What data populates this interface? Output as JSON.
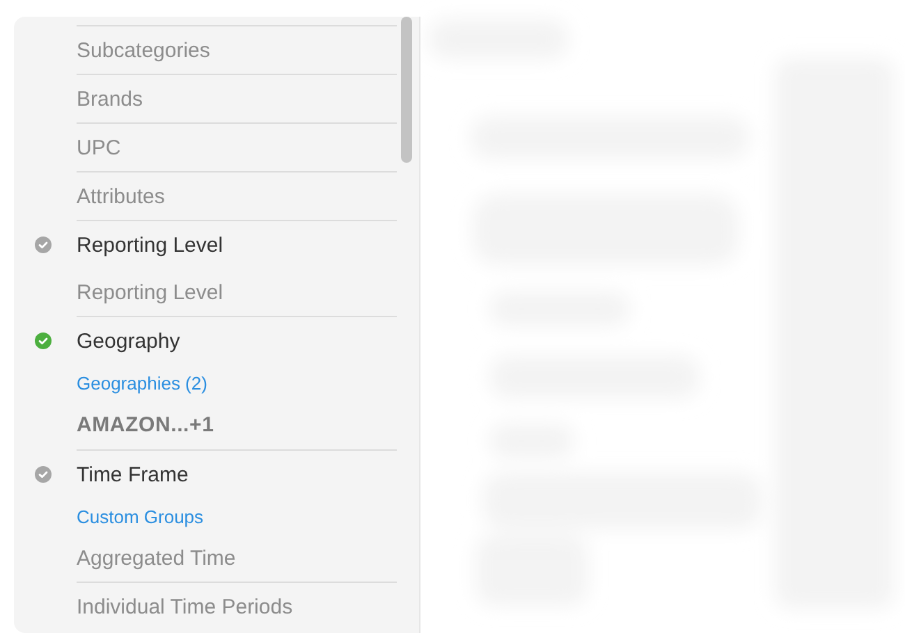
{
  "filter_groups": [
    {
      "items": [
        {
          "kind": "option",
          "label": "Subcategories"
        }
      ]
    },
    {
      "items": [
        {
          "kind": "option",
          "label": "Brands"
        }
      ]
    },
    {
      "items": [
        {
          "kind": "option",
          "label": "UPC"
        }
      ]
    },
    {
      "items": [
        {
          "kind": "option",
          "label": "Attributes"
        }
      ]
    },
    {
      "items": [
        {
          "kind": "header",
          "label": "Reporting Level",
          "complete": false
        },
        {
          "kind": "option",
          "label": "Reporting Level"
        }
      ]
    },
    {
      "items": [
        {
          "kind": "header",
          "label": "Geography",
          "complete": true
        },
        {
          "kind": "link",
          "label": "Geographies (2)"
        },
        {
          "kind": "value",
          "label": "AMAZON...+1"
        }
      ]
    },
    {
      "items": [
        {
          "kind": "header",
          "label": "Time Frame",
          "complete": false
        },
        {
          "kind": "link",
          "label": "Custom Groups"
        },
        {
          "kind": "option",
          "label": "Aggregated Time"
        }
      ]
    },
    {
      "items": [
        {
          "kind": "option",
          "label": "Individual Time Periods"
        }
      ]
    }
  ]
}
